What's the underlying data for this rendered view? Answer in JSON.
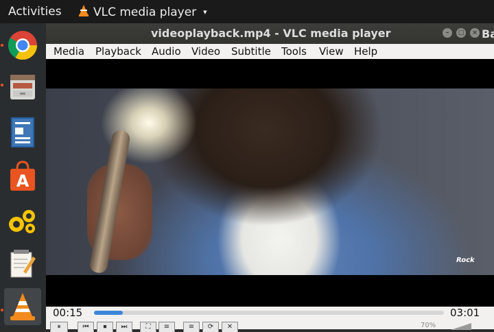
{
  "topbar": {
    "activities_label": "Activities",
    "app_name": "VLC media player",
    "caret": "▾"
  },
  "dock": {
    "items": [
      {
        "name": "chrome-icon",
        "running": true
      },
      {
        "name": "files-icon",
        "running": true
      },
      {
        "name": "writer-icon",
        "running": false
      },
      {
        "name": "software-icon",
        "running": false
      },
      {
        "name": "gears-icon",
        "running": false
      },
      {
        "name": "text-editor-icon",
        "running": false
      },
      {
        "name": "vlc-icon",
        "running": true,
        "active": true
      }
    ]
  },
  "window": {
    "title": "videoplayback.mp4 - VLC media player",
    "behind_title_fragment": "Ba",
    "buttons": {
      "minimize": "–",
      "maximize": "□",
      "close": "×"
    }
  },
  "menubar": {
    "items": [
      {
        "label": "Media"
      },
      {
        "label": "Playback"
      },
      {
        "label": "Audio"
      },
      {
        "label": "Video"
      },
      {
        "label": "Subtitle"
      },
      {
        "label": "Tools"
      },
      {
        "label": "View"
      },
      {
        "label": "Help"
      }
    ]
  },
  "video": {
    "watermark": "Rock"
  },
  "controls": {
    "elapsed": "00:15",
    "duration": "03:01",
    "progress": 0.083,
    "volume": "70%",
    "buttons": [
      "⏸",
      "⏮",
      "⏹",
      "⏭",
      "⛶",
      "≡",
      "⟳",
      "✕"
    ]
  },
  "colors": {
    "accent": "#3b86d8",
    "ubuntu_orange": "#e95420"
  }
}
